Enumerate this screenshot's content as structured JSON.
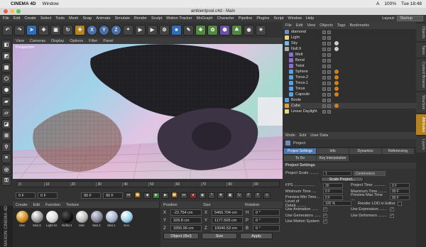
{
  "mac": {
    "apple": "",
    "app_name": "CINEMA 4D",
    "menu": [
      "Window"
    ],
    "status": {
      "flag": "A",
      "battery": "100%",
      "time": "Tue 18:48"
    }
  },
  "window": {
    "title": "ambientpool.c4d - Main"
  },
  "app_menu": {
    "items": [
      "File",
      "Edit",
      "Create",
      "Select",
      "Tools",
      "Mesh",
      "Snap",
      "Animate",
      "Simulate",
      "Render",
      "Sculpt",
      "Motion Tracker",
      "MoGraph",
      "Character",
      "Pipeline",
      "Plugins",
      "Script",
      "Window",
      "Help"
    ],
    "layout_label": "Layout:",
    "layout_value": "Startup"
  },
  "toolbar": {
    "tools": [
      {
        "glyph": "↶",
        "icon": "undo-icon",
        "style": ""
      },
      {
        "glyph": "↷",
        "icon": "redo-icon",
        "style": ""
      },
      {
        "glyph": "➤",
        "icon": "select-arrow-icon",
        "style": "b"
      },
      {
        "glyph": "✥",
        "icon": "move-icon",
        "style": ""
      },
      {
        "glyph": "▣",
        "icon": "scale-icon",
        "style": ""
      },
      {
        "glyph": "↻",
        "icon": "rotate-icon",
        "style": ""
      },
      {
        "glyph": "✚",
        "icon": "add-icon",
        "style": "o"
      },
      {
        "glyph": "X",
        "icon": "x-axis-icon",
        "style": "c"
      },
      {
        "glyph": "Y",
        "icon": "y-axis-icon",
        "style": "c"
      },
      {
        "glyph": "Z",
        "icon": "z-axis-icon",
        "style": "c"
      },
      {
        "glyph": "⌖",
        "icon": "coord-system-icon",
        "style": ""
      },
      {
        "glyph": "▶",
        "icon": "render-view-icon",
        "style": ""
      },
      {
        "glyph": "▶",
        "icon": "render-picture-viewer-icon",
        "style": ""
      },
      {
        "glyph": "⚙",
        "icon": "render-settings-icon",
        "style": ""
      },
      {
        "glyph": "■",
        "icon": "cube-icon",
        "style": "b"
      },
      {
        "glyph": "✎",
        "icon": "pen-icon",
        "style": ""
      },
      {
        "glyph": "❖",
        "icon": "subdivision-icon",
        "style": "g"
      },
      {
        "glyph": "✿",
        "icon": "cloner-icon",
        "style": "g"
      },
      {
        "glyph": "⬢",
        "icon": "deformer-icon",
        "style": "p"
      },
      {
        "glyph": "⛰",
        "icon": "environment-icon",
        "style": "g"
      },
      {
        "glyph": "◉",
        "icon": "camera-icon",
        "style": ""
      },
      {
        "glyph": "☀",
        "icon": "light-icon",
        "style": ""
      }
    ]
  },
  "left_tools": [
    {
      "glyph": "◧",
      "icon": "make-editable-icon"
    },
    {
      "glyph": "◩",
      "icon": "model-mode-icon"
    },
    {
      "glyph": "▦",
      "icon": "texture-mode-icon"
    },
    {
      "glyph": "⬡",
      "icon": "points-mode-icon"
    },
    {
      "glyph": "⬢",
      "icon": "edges-mode-icon"
    },
    {
      "glyph": "▰",
      "icon": "polygons-mode-icon"
    },
    {
      "glyph": "▱",
      "icon": "uv-mode-icon"
    },
    {
      "glyph": "◪",
      "icon": "axis-mode-icon"
    },
    {
      "glyph": "⊞",
      "icon": "snap-icon"
    },
    {
      "glyph": "⚲",
      "icon": "workplane-icon"
    },
    {
      "glyph": "⌗",
      "icon": "grid-icon"
    },
    {
      "glyph": "◎",
      "icon": "locked-workplane-icon"
    },
    {
      "glyph": "⚿",
      "icon": "lock-icon"
    }
  ],
  "viewport": {
    "menu": [
      "View",
      "Cameras",
      "Display",
      "Options",
      "Filter",
      "Panel"
    ],
    "label": "Perspective"
  },
  "timeline": {
    "ruler_ticks": [
      "0",
      "10",
      "20",
      "30",
      "40",
      "50",
      "60",
      "70",
      "80",
      "90"
    ],
    "start_frame": "0 F",
    "current_frame": "0 F",
    "end_frame": "90 F",
    "end_frame2": "90 F",
    "frame_counter": "0 F"
  },
  "materials": {
    "menu": [
      "Create",
      "Edit",
      "Function",
      "Texture"
    ],
    "items": [
      {
        "name": "Mat",
        "color": "radial-gradient(circle at 35% 30%,#ffe9a8,#c7861f 60%,#4a2a05)"
      },
      {
        "name": "Mat.3",
        "color": "radial-gradient(circle at 35% 30%,#ffffff,#9a9a9a 55%,#2a2a2a)"
      },
      {
        "name": "Light M.",
        "color": "radial-gradient(circle at 35% 30%,#ffffff,#dddddd 50%,#777)"
      },
      {
        "name": "Reflect",
        "color": "radial-gradient(circle at 35% 30%,#555,#111 60%,#000)"
      },
      {
        "name": "Mat",
        "color": "radial-gradient(circle at 35% 30%,#ffffff,#bbbbbb 55%,#444)"
      },
      {
        "name": "Mat.2",
        "color": "radial-gradient(circle at 35% 30%,#dde,#889 55%,#223)"
      },
      {
        "name": "Mat.1",
        "color": "radial-gradient(circle at 35% 30%,#eef,#a8b4c8 55%,#334)"
      },
      {
        "name": "Sun",
        "color": "radial-gradient(circle at 35% 30%,#fff,#9ad0e8 55%,#345)"
      }
    ]
  },
  "brand": "MAXON CINEMA 4D",
  "coordinates": {
    "headers": [
      "Position",
      "Size",
      "Rotation"
    ],
    "rows": [
      {
        "pos_axis": "X",
        "pos": "-22.754 cm",
        "size_axis": "X",
        "size": "5460.704 cm",
        "rot_axis": "H",
        "rot": "0 °"
      },
      {
        "pos_axis": "Y",
        "pos": "328.8 cm",
        "size_axis": "Y",
        "size": "1177.505 cm",
        "rot_axis": "P",
        "rot": "0 °"
      },
      {
        "pos_axis": "Z",
        "pos": "3355.96 cm",
        "size_axis": "Z",
        "size": "10040.53 cm",
        "rot_axis": "B",
        "rot": "0 °"
      }
    ],
    "mode": "Object (Rel)",
    "size_mode": "Size",
    "apply": "Apply"
  },
  "objects": {
    "menu": [
      "File",
      "Edit",
      "View",
      "Objects",
      "Tags",
      "Bookmarks"
    ],
    "items": [
      {
        "name": "diamond",
        "indent": 0,
        "color": "#6a8fc7",
        "tag": ""
      },
      {
        "name": "Light",
        "indent": 0,
        "color": "#e8d37a",
        "tag": ""
      },
      {
        "name": "Sky",
        "indent": 0,
        "color": "#7ab6e8",
        "tag": "#ccc"
      },
      {
        "name": "Null.9",
        "indent": 0,
        "color": "#aaa",
        "tag": "#ccc"
      },
      {
        "name": "Melt",
        "indent": 1,
        "color": "#8a6fd1",
        "tag": ""
      },
      {
        "name": "Bend",
        "indent": 1,
        "color": "#8a6fd1",
        "tag": ""
      },
      {
        "name": "Twist",
        "indent": 1,
        "color": "#8a6fd1",
        "tag": ""
      },
      {
        "name": "Sphere",
        "indent": 1,
        "color": "#5aa0e0",
        "tag": "#d08020"
      },
      {
        "name": "Torus.2",
        "indent": 1,
        "color": "#5aa0e0",
        "tag": "#d08020"
      },
      {
        "name": "Torus.1",
        "indent": 1,
        "color": "#5aa0e0",
        "tag": "#d08020"
      },
      {
        "name": "Torus",
        "indent": 1,
        "color": "#5aa0e0",
        "tag": "#d08020"
      },
      {
        "name": "Capsule",
        "indent": 1,
        "color": "#5aa0e0",
        "tag": "#d08020"
      },
      {
        "name": "Boole",
        "indent": 0,
        "color": "#5aa0e0",
        "tag": ""
      },
      {
        "name": "Cube",
        "indent": 0,
        "color": "#e0a030",
        "tag": "#d08020"
      },
      {
        "name": "Linear Daylight",
        "indent": 0,
        "color": "#e8d37a",
        "tag": ""
      }
    ]
  },
  "side_tabs": [
    "Objects",
    "Takes",
    "Content Browser",
    "Structure",
    "Attributes",
    "Layers"
  ],
  "attributes": {
    "menu": [
      "Mode",
      "Edit",
      "User Data"
    ],
    "title": "Project",
    "tabs": [
      {
        "label": "Project Settings",
        "on": true
      },
      {
        "label": "Info",
        "on": false
      },
      {
        "label": "Dynamics",
        "on": false
      },
      {
        "label": "Referencing",
        "on": false
      },
      {
        "label": "To Do",
        "on": false
      },
      {
        "label": "Key Interpolation",
        "on": false
      }
    ],
    "section": "Project Settings",
    "project_scale_label": "Project Scale ........",
    "project_scale_value": "1",
    "project_scale_unit": "Centimeters",
    "scale_button": "Scale Project...",
    "fields": [
      {
        "l1": "FPS ...................",
        "v1": "30",
        "l2": "Project Time ...........",
        "v2": "0 F"
      },
      {
        "l1": "Minimum Time ....",
        "v1": "0 F",
        "l2": "Maximum Time ........",
        "v2": "90 F"
      },
      {
        "l1": "Preview Min Time...",
        "v1": "0 F",
        "l2": "Preview Max Time ....",
        "v2": "90 F"
      }
    ],
    "lod_label": "Level of Detail..........",
    "lod_value": "100 %",
    "render_lod_label": "Render LOD in Editor",
    "checks": [
      {
        "l1": "Use Animation ......",
        "c1": "✓",
        "l2": "Use Expression........",
        "c2": "✓"
      },
      {
        "l1": "Use Generators ......",
        "c1": "✓",
        "l2": "Use Deformers ........",
        "c2": "✓"
      },
      {
        "l1": "Use Motion System",
        "c1": "✓",
        "l2": "",
        "c2": ""
      }
    ]
  }
}
